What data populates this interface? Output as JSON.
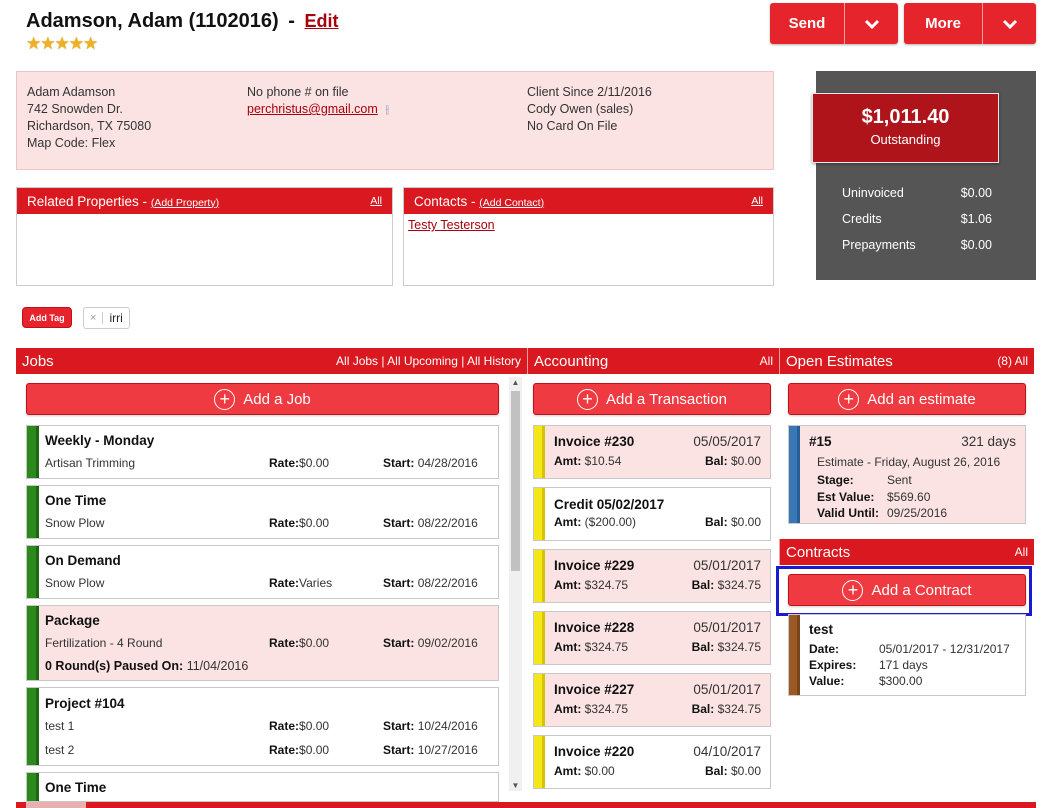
{
  "header": {
    "client_name": "Adamson, Adam (1102016)",
    "separator": "-",
    "edit_label": "Edit",
    "stars": "★★★★★",
    "send_label": "Send",
    "more_label": "More"
  },
  "client_info": {
    "address": [
      "Adam Adamson",
      "742 Snowden Dr.",
      "Richardson, TX 75080",
      "Map Code: Flex"
    ],
    "phone": "No phone # on file",
    "email": "perchristus@gmail.com",
    "email_tool_icon": "⫲",
    "meta": [
      "Client Since 2/11/2016",
      "Cody Owen (sales)",
      "No Card On File"
    ]
  },
  "balance": {
    "amount": "$1,011.40",
    "label": "Outstanding",
    "rows": [
      {
        "label": "Uninvoiced",
        "value": "$0.00"
      },
      {
        "label": "Credits",
        "value": "$1.06"
      },
      {
        "label": "Prepayments",
        "value": "$0.00"
      }
    ]
  },
  "related": {
    "title": "Related Properties - ",
    "add_label": "(Add Property)",
    "all_label": "All"
  },
  "contacts": {
    "title": "Contacts - ",
    "add_label": "(Add Contact)",
    "all_label": "All",
    "items": [
      "Testy Testerson"
    ]
  },
  "tags": {
    "add_label": "Add Tag",
    "remove_symbol": "×",
    "items": [
      "irri"
    ]
  },
  "jobs": {
    "title": "Jobs",
    "links": "All Jobs | All Upcoming | All History",
    "add_label": "Add a Job",
    "cards": [
      {
        "title": "Weekly - Monday",
        "sub": "Artisan Trimming",
        "rate_label": "Rate:",
        "rate": "$0.00",
        "start_label": "Start:",
        "start": "04/28/2016"
      },
      {
        "title": "One Time",
        "sub": "Snow Plow",
        "rate_label": "Rate:",
        "rate": "$0.00",
        "start_label": "Start:",
        "start": "08/22/2016"
      },
      {
        "title": "On Demand",
        "sub": "Snow Plow",
        "rate_label": "Rate:",
        "rate": "Varies",
        "start_label": "Start:",
        "start": "08/22/2016"
      },
      {
        "title": "Package",
        "sub": "Fertilization - 4 Round",
        "rate_label": "Rate:",
        "rate": "$0.00",
        "start_label": "Start:",
        "start": "09/02/2016",
        "extra_bold": "0 Round(s) Paused On:",
        "extra_date": "11/04/2016"
      },
      {
        "title": "Project #104",
        "rows": [
          {
            "sub": "test 1",
            "rate_label": "Rate:",
            "rate": "$0.00",
            "start_label": "Start:",
            "start": "10/24/2016"
          },
          {
            "sub": "test 2",
            "rate_label": "Rate:",
            "rate": "$0.00",
            "start_label": "Start:",
            "start": "10/27/2016"
          }
        ]
      },
      {
        "title": "One Time"
      }
    ]
  },
  "accounting": {
    "title": "Accounting",
    "all_label": "All",
    "add_label": "Add a Transaction",
    "cards": [
      {
        "title": "Invoice #230",
        "date": "05/05/2017",
        "amt_label": "Amt:",
        "amt": "$10.54",
        "bal_label": "Bal:",
        "bal": "$0.00"
      },
      {
        "title": "Credit 05/02/2017",
        "date": "",
        "amt_label": "Amt:",
        "amt": "($200.00)",
        "bal_label": "Bal:",
        "bal": "$0.00"
      },
      {
        "title": "Invoice #229",
        "date": "05/01/2017",
        "amt_label": "Amt:",
        "amt": "$324.75",
        "bal_label": "Bal:",
        "bal": "$324.75"
      },
      {
        "title": "Invoice #228",
        "date": "05/01/2017",
        "amt_label": "Amt:",
        "amt": "$324.75",
        "bal_label": "Bal:",
        "bal": "$324.75"
      },
      {
        "title": "Invoice #227",
        "date": "05/01/2017",
        "amt_label": "Amt:",
        "amt": "$324.75",
        "bal_label": "Bal:",
        "bal": "$324.75"
      },
      {
        "title": "Invoice #220",
        "date": "04/10/2017",
        "amt_label": "Amt:",
        "amt": "$0.00",
        "bal_label": "Bal:",
        "bal": "$0.00"
      }
    ]
  },
  "estimates": {
    "title": "Open Estimates",
    "count_all": "(8) All",
    "add_label": "Add an estimate",
    "card": {
      "title": "#15",
      "days": "321 days",
      "sub": "Estimate - Friday, August 26, 2016",
      "rows": [
        {
          "label": "Stage:",
          "value": "Sent"
        },
        {
          "label": "Est Value:",
          "value": "$569.60"
        },
        {
          "label": "Valid Until:",
          "value": "09/25/2016"
        }
      ]
    }
  },
  "contracts": {
    "title": "Contracts",
    "all_label": "All",
    "add_label": "Add a Contract",
    "card": {
      "title": "test",
      "rows": [
        {
          "label": "Date:",
          "value": "05/01/2017 - 12/31/2017"
        },
        {
          "label": "Expires:",
          "value": "171 days"
        },
        {
          "label": "Value:",
          "value": "$300.00"
        }
      ]
    }
  },
  "colors": {
    "brand_red": "#d9181f",
    "button_red": "#ef3a42",
    "pink_bg": "#fbe3e3",
    "job_green": "#2c8a1c",
    "invoice_yellow": "#f5e61a",
    "estimate_blue": "#3a77b5",
    "contract_brown": "#9b5a25",
    "highlight_blue": "#1a1ad0"
  }
}
